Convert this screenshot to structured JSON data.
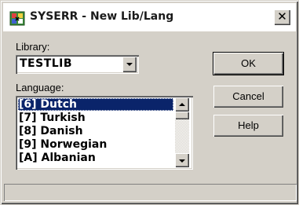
{
  "window": {
    "title": "SYSERR - New Lib/Lang",
    "close_glyph": "✕",
    "app_icon": "syserr-app-icon"
  },
  "library": {
    "label": "Library:",
    "value": "TESTLIB"
  },
  "language": {
    "label": "Language:",
    "items": [
      "[6] Dutch",
      "[7] Turkish",
      "[8] Danish",
      "[9] Norwegian",
      "[A] Albanian"
    ],
    "selected_index": 0
  },
  "buttons": {
    "ok": "OK",
    "cancel": "Cancel",
    "help": "Help"
  },
  "status": {
    "text": ""
  },
  "colors": {
    "face": "#d4d0c8",
    "selection": "#0a246a"
  }
}
